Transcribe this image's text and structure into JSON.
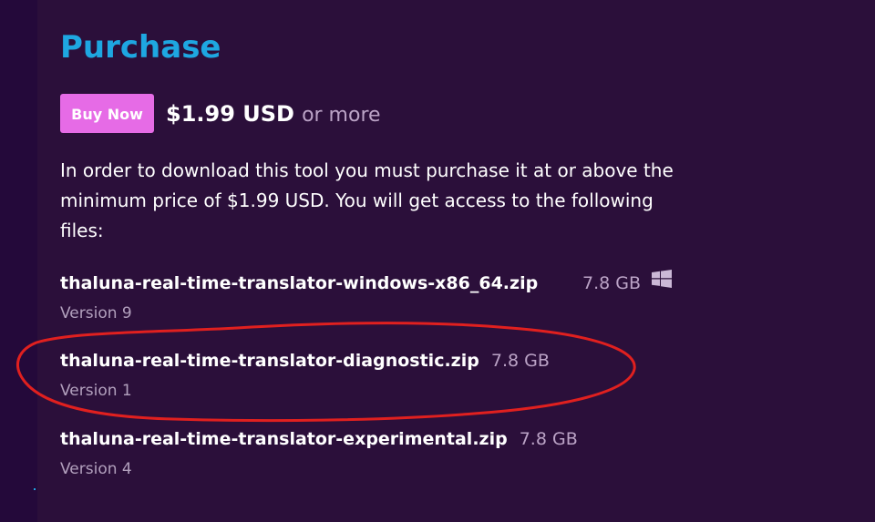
{
  "purchase": {
    "title": "Purchase",
    "buy_button": "Buy Now",
    "price": "$1.99 USD",
    "price_suffix": "or more",
    "description": "In order to download this tool you must purchase it at or above the minimum price of $1.99 USD. You will get access to the following files:"
  },
  "files": [
    {
      "name": "thaluna-real-time-translator-windows-x86_64.zip",
      "size": "7.8 GB",
      "version": "Version 9",
      "platform_icon": "windows-icon"
    },
    {
      "name": "thaluna-real-time-translator-diagnostic.zip",
      "size": "7.8 GB",
      "version": "Version 1"
    },
    {
      "name": "thaluna-real-time-translator-experimental.zip",
      "size": "7.8 GB",
      "version": "Version 4"
    }
  ],
  "colors": {
    "background": "#2b0f3a",
    "title": "#1ea7e1",
    "button": "#e66be6",
    "annotation_circle": "#e0201f"
  }
}
